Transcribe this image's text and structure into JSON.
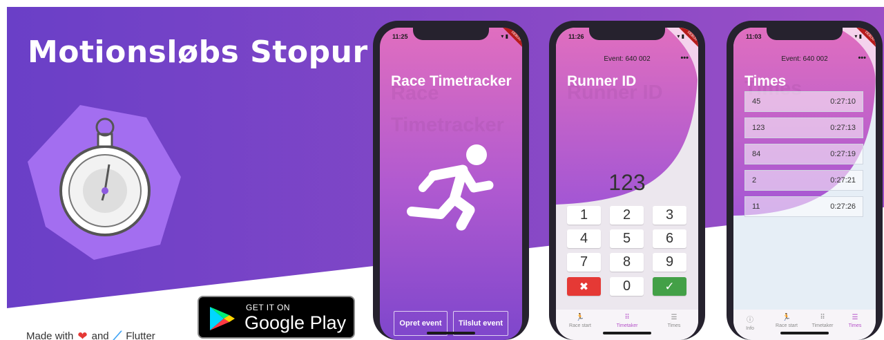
{
  "app_title": "Motionsløbs Stopur",
  "colors": {
    "brand_purple": "#7b3fc7",
    "accent_pink": "#e06ebf",
    "green": "#43a047",
    "red": "#e53935"
  },
  "logo": {
    "icon": "stopwatch-icon"
  },
  "made_with": {
    "prefix": "Made with",
    "heart": "heart-icon",
    "and": "and",
    "flutter": "Flutter"
  },
  "play_badge": {
    "line1": "GET IT ON",
    "line2": "Google Play"
  },
  "phone1": {
    "time": "11:25",
    "status": "▾ ▮",
    "debug": "DEBUG",
    "title": "Race Timetracker",
    "ghost_title": "Race Timetracker",
    "icon": "running-person-icon",
    "buttons": [
      "Opret event",
      "Tilslut event"
    ]
  },
  "phone2": {
    "time": "11:26",
    "status": "▾ ▮",
    "debug": "DEBUG",
    "header": "Event: 640 002",
    "menu": "•••",
    "title": "Runner ID",
    "ghost_title": "Runner ID",
    "display": "123",
    "keys": [
      "1",
      "2",
      "3",
      "4",
      "5",
      "6",
      "7",
      "8",
      "9",
      "✖",
      "0",
      "✓"
    ],
    "tabs": [
      {
        "icon": "runner-icon",
        "label": "Race start"
      },
      {
        "icon": "keypad-icon",
        "label": "Timetaker"
      },
      {
        "icon": "list-icon",
        "label": "Times"
      }
    ]
  },
  "phone3": {
    "time": "11:03",
    "status": "▾ ▮",
    "debug": "DEBUG",
    "header": "Event: 640 002",
    "menu": "•••",
    "title": "Times",
    "ghost_title": "Times",
    "rows": [
      {
        "id": "45",
        "time": "0:27:10"
      },
      {
        "id": "123",
        "time": "0:27:13"
      },
      {
        "id": "84",
        "time": "0:27:19"
      },
      {
        "id": "2",
        "time": "0:27:21"
      },
      {
        "id": "11",
        "time": "0:27:26"
      }
    ],
    "tabs": [
      {
        "icon": "info-icon",
        "label": "Info"
      },
      {
        "icon": "runner-icon",
        "label": "Race start"
      },
      {
        "icon": "keypad-icon",
        "label": "Timetaker"
      },
      {
        "icon": "list-icon",
        "label": "Times"
      }
    ]
  }
}
